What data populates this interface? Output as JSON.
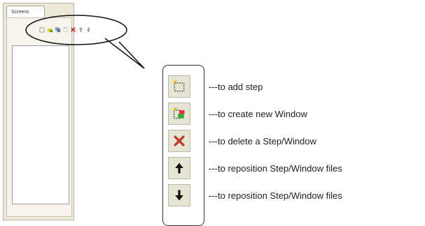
{
  "panel": {
    "tab_label": "Screens",
    "toolbar_icons": [
      "add-step-icon",
      "new-window-icon",
      "copy-icon",
      "paste-icon",
      "delete-icon",
      "move-up-icon",
      "move-down-icon"
    ]
  },
  "legend": {
    "items": [
      {
        "icon": "add-step-icon",
        "text": "---to add step"
      },
      {
        "icon": "new-window-icon",
        "text": "---to create new Window"
      },
      {
        "icon": "delete-icon",
        "text": "---to delete a Step/Window"
      },
      {
        "icon": "move-up-icon",
        "text": "---to reposition Step/Window files"
      },
      {
        "icon": "move-down-icon",
        "text": "---to reposition Step/Window files"
      }
    ]
  },
  "colors": {
    "panel_bg": "#ece9d8",
    "delete_red": "#c0392b",
    "new_window_green": "#3aa53a"
  }
}
